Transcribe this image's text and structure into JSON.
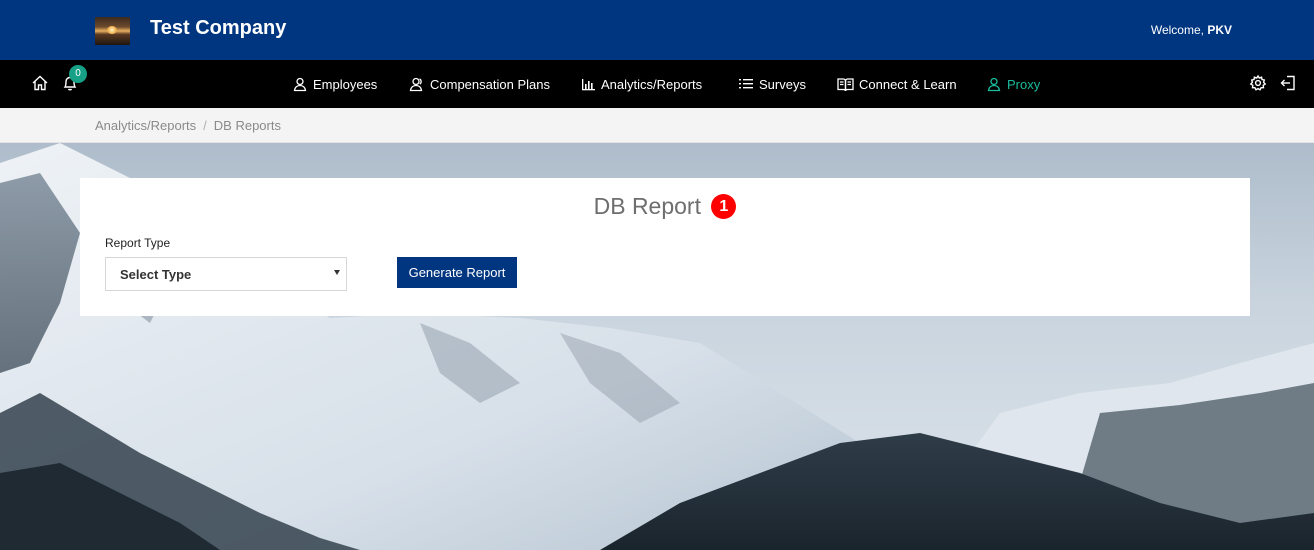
{
  "header": {
    "company_name": "Test Company",
    "welcome_prefix": "Welcome, ",
    "user_name": "PKV",
    "brand_color": "#003580"
  },
  "nav": {
    "notification_count": "0",
    "items": [
      {
        "label": "Employees",
        "icon": "user-icon"
      },
      {
        "label": "Compensation Plans",
        "icon": "users-icon"
      },
      {
        "label": "Analytics/Reports",
        "icon": "bar-chart-icon"
      },
      {
        "label": "Surveys",
        "icon": "list-icon"
      },
      {
        "label": "Connect & Learn",
        "icon": "book-icon"
      },
      {
        "label": "Proxy",
        "icon": "user-icon",
        "color": "#1abc9c"
      }
    ]
  },
  "breadcrumb": {
    "items": [
      "Analytics/Reports",
      "DB Reports"
    ],
    "separator": "/"
  },
  "card": {
    "title": "DB Report",
    "badge": "1",
    "report_type_label": "Report Type",
    "report_type_value": "Select Type",
    "generate_label": "Generate Report"
  }
}
